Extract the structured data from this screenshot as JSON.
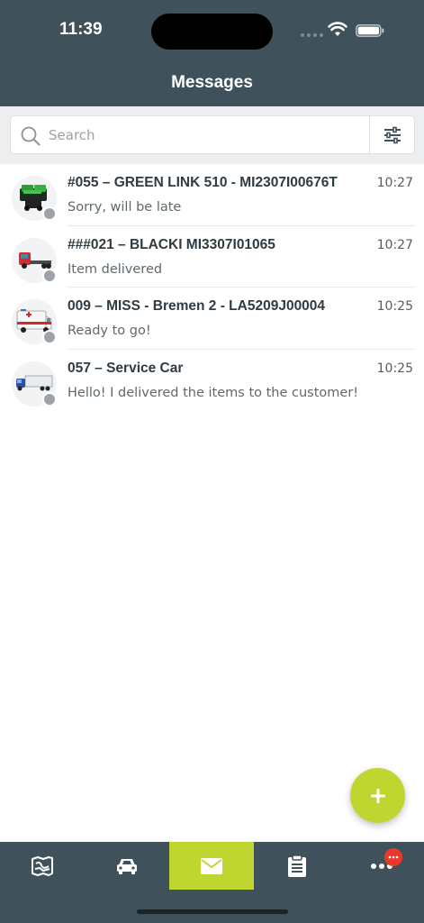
{
  "status_bar": {
    "time": "11:39"
  },
  "header": {
    "title": "Messages"
  },
  "search": {
    "placeholder": "Search",
    "value": ""
  },
  "messages": [
    {
      "title": "#055 – GREEN LINK 510 - MI2307I00676T",
      "time": "10:27",
      "preview": "Sorry, will be late",
      "icon": "green-cab-truck-icon"
    },
    {
      "title": "###021 – BLACKI MI3307I01065",
      "time": "10:27",
      "preview": "Item delivered",
      "icon": "red-flatbed-truck-icon"
    },
    {
      "title": "009 – MISS - Bremen 2 - LA5209J00004",
      "time": "10:25",
      "preview": "Ready to go!",
      "icon": "ambulance-icon"
    },
    {
      "title": "057 – Service Car",
      "time": "10:25",
      "preview": "Hello! I delivered the items to the customer!",
      "icon": "blue-semi-truck-icon"
    }
  ],
  "tabbar": {
    "items": [
      "map-icon",
      "car-icon",
      "envelope-icon",
      "clipboard-icon",
      "more-icon"
    ],
    "active": "envelope-icon",
    "badge_glyph": "..."
  },
  "colors": {
    "header": "#3f515a",
    "accent": "#bfd630",
    "badge": "#e8392b",
    "status_dot": "#9da3a8"
  }
}
